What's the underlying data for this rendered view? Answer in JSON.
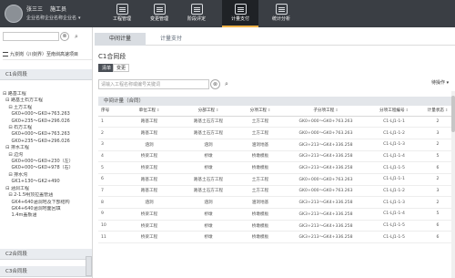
{
  "header": {
    "user_name": "张三三",
    "user_role": "施工员",
    "org": "企业名称企业名称企业名",
    "org_caret": "▾",
    "nav": [
      {
        "label": "工程管理",
        "icon": "project-icon",
        "active": false
      },
      {
        "label": "变更管理",
        "icon": "change-icon",
        "active": false
      },
      {
        "label": "阶段评定",
        "icon": "evaluation-icon",
        "active": false
      },
      {
        "label": "计量支付",
        "icon": "payment-icon",
        "active": true
      },
      {
        "label": "统计分析",
        "icon": "statistics-icon",
        "active": false
      }
    ]
  },
  "left_panel": {
    "search_clear": "⊗",
    "search_icon": "⌕",
    "project_title": "九崇岗（川剑界）至南圳高速项目",
    "sections": [
      "C1合同段",
      "C2合同段",
      "C3合同段"
    ],
    "tree": [
      "⊟ 路基工程",
      "  ⊟ 路基土石方工程",
      "    ⊟ 土方工程",
      "      GK0+000～GK0+763.263",
      "      GK0+235～GK0+296.026",
      "    ⊟ 石方工程",
      "      GK0+000～GK0+763.263",
      "      GK0+235～GK0+296.026",
      "  ⊟ 排水工程",
      "    ⊟ 边沟",
      "      GK0+000～GK0+230（左）",
      "      GK0+000～GK0+978（右）",
      "    ⊟ 排水沟",
      "      GK1+130～GK2+490",
      "  ⊟ 涵洞工程",
      "    ⊟ 2-1.5明顶拉盖管涵",
      "      GK4+640涵洞地及下部结构",
      "      GK4+640涵洞地面回填",
      "      1.4m盖板涵"
    ]
  },
  "main": {
    "tabs": [
      "中间计量",
      "计量支付"
    ],
    "heading": "C1合同段",
    "chips": [
      "清单",
      "变更"
    ],
    "search_placeholder": "请输入工程名称或编号关键词",
    "search_clear": "⊗",
    "search_icon": "⌕",
    "status_select": "待操作 ▾",
    "table_group": "中间计量（合同）",
    "columns": [
      "序号",
      "单位工程",
      "分部工程",
      "分项工程",
      "子分项工程",
      "分项工程编号",
      "计量状态"
    ],
    "sort_glyph": "⇕",
    "rows": [
      [
        "1",
        "路基工程",
        "路基土石方工程",
        "土方工程",
        "GK0+000～GK0+763.263",
        "C1-LJ1-1-1",
        "2"
      ],
      [
        "2",
        "路基工程",
        "路基土石方工程",
        "土方工程",
        "GK0+000～GK0+763.263",
        "C1-LJ1-1-2",
        "3"
      ],
      [
        "3",
        "涵洞",
        "涵洞",
        "涵洞地基",
        "GK3+213～GK4+336.258",
        "C1-LJ1-1-3",
        "2"
      ],
      [
        "4",
        "桥梁工程",
        "桥墩",
        "桥墩模板",
        "GK3+213～GK4+336.258",
        "C1-LJ1-1-4",
        "5"
      ],
      [
        "5",
        "桥梁工程",
        "桥墩",
        "桥墩模板",
        "GK3+213～GK4+336.258",
        "C1-LJ1-1-5",
        "6"
      ],
      [
        "6",
        "路基工程",
        "路基土石方工程",
        "土方工程",
        "GK0+000～GK0+763.263",
        "C1-LJ1-1-1",
        "2"
      ],
      [
        "7",
        "路基工程",
        "路基土石方工程",
        "土方工程",
        "GK0+000～GK0+763.263",
        "C1-LJ1-1-2",
        "3"
      ],
      [
        "8",
        "涵洞",
        "涵洞",
        "涵洞地基",
        "GK3+213～GK4+336.258",
        "C1-LJ1-1-3",
        "2"
      ],
      [
        "9",
        "桥梁工程",
        "桥墩",
        "桥墩模板",
        "GK3+213～GK4+336.258",
        "C1-LJ1-1-4",
        "5"
      ],
      [
        "10",
        "桥梁工程",
        "桥墩",
        "桥墩模板",
        "GK3+213～GK4+336.258",
        "C1-LJ1-1-5",
        "6"
      ],
      [
        "11",
        "桥梁工程",
        "桥墩",
        "桥墩模板",
        "GK3+213～GK4+336.258",
        "C1-LJ1-1-5",
        "6"
      ]
    ]
  }
}
